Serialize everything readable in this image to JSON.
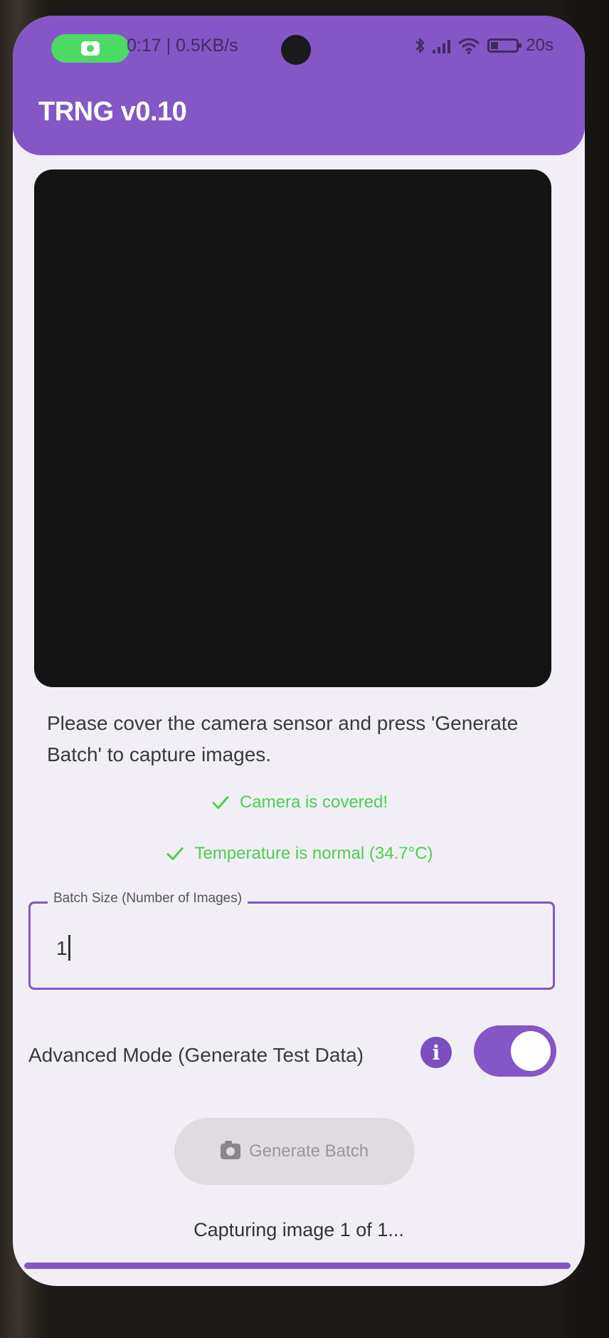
{
  "status_bar": {
    "recording_icon": "camera-icon",
    "left_text": "0:17 | 0.5KB/s",
    "bluetooth_icon": "bluetooth-icon",
    "signal_icon": "signal-icon",
    "wifi_icon": "wifi-icon",
    "battery_icon": "battery-icon",
    "right_text": "20s",
    "accent_color": "#4cd964"
  },
  "app_bar": {
    "title": "TRNG v0.10",
    "color": "#8556c6"
  },
  "camera_preview": {
    "state": "covered"
  },
  "instructions": "Please cover the camera sensor and press 'Generate Batch' to capture images.",
  "checks": {
    "icon": "check-icon",
    "color": "#4ccf50",
    "camera": "Camera is covered!",
    "temperature": "Temperature is normal (34.7°C)"
  },
  "batch_field": {
    "label": "Batch Size (Number of Images)",
    "value": "1"
  },
  "advanced_mode": {
    "label": "Advanced Mode (Generate Test Data)",
    "info_icon": "info-icon",
    "info_glyph": "i",
    "enabled": true
  },
  "generate_button": {
    "icon": "camera-icon",
    "label": "Generate Batch",
    "enabled": false
  },
  "progress": {
    "text": "Capturing image 1 of 1...",
    "fraction": 1.0
  }
}
